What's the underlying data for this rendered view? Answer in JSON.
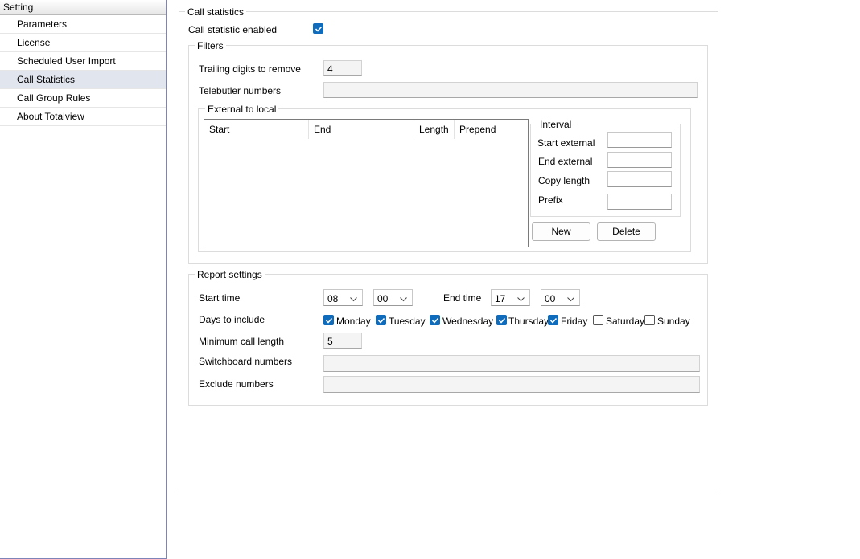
{
  "sidebar": {
    "header": "Setting",
    "items": [
      {
        "label": "Parameters"
      },
      {
        "label": "License"
      },
      {
        "label": "Scheduled User Import"
      },
      {
        "label": "Call Statistics"
      },
      {
        "label": "Call Group Rules"
      },
      {
        "label": "About Totalview"
      }
    ]
  },
  "call_statistics": {
    "title": "Call statistics",
    "enabled_label": "Call statistic enabled",
    "enabled": true,
    "filters": {
      "title": "Filters",
      "trailing_digits_label": "Trailing digits to remove",
      "trailing_digits_value": "4",
      "telebutler_label": "Telebutler numbers",
      "telebutler_value": "",
      "external_to_local": {
        "title": "External to local",
        "columns": [
          "Start",
          "End",
          "Length",
          "Prepend"
        ],
        "interval": {
          "title": "Interval",
          "start_external_label": "Start external",
          "end_external_label": "End external",
          "copy_length_label": "Copy length",
          "prefix_label": "Prefix"
        },
        "new_button": "New",
        "delete_button": "Delete"
      }
    },
    "report": {
      "title": "Report settings",
      "start_time_label": "Start time",
      "start_hour": "08",
      "start_minute": "00",
      "end_time_label": "End time",
      "end_hour": "17",
      "end_minute": "00",
      "days_label": "Days to include",
      "days": [
        {
          "label": "Monday",
          "checked": true
        },
        {
          "label": "Tuesday",
          "checked": true
        },
        {
          "label": "Wednesday",
          "checked": true
        },
        {
          "label": "Thursday",
          "checked": true
        },
        {
          "label": "Friday",
          "checked": true
        },
        {
          "label": "Saturday",
          "checked": false
        },
        {
          "label": "Sunday",
          "checked": false
        }
      ],
      "min_length_label": "Minimum call length",
      "min_length_value": "5",
      "switchboard_label": "Switchboard numbers",
      "exclude_label": "Exclude numbers"
    }
  },
  "icons": {
    "checkbox": "checkmark-icon",
    "dropdown": "chevron-down-icon"
  }
}
